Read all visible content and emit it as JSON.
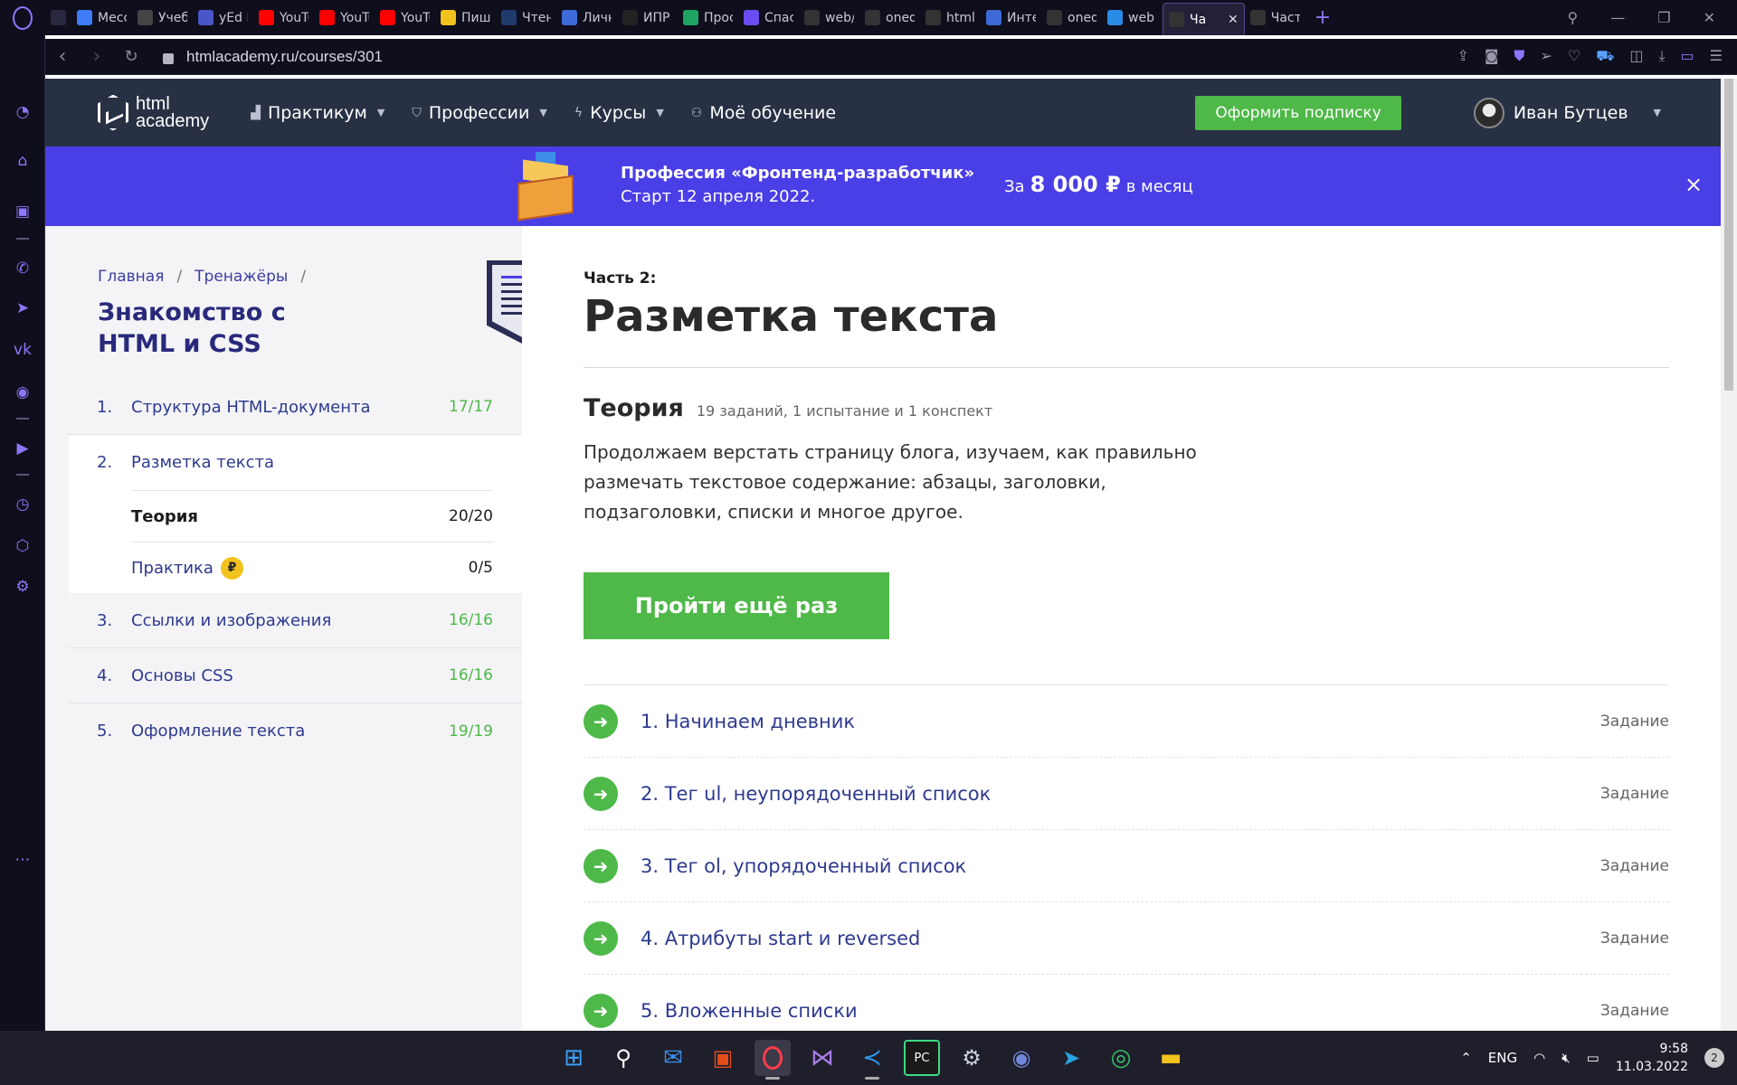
{
  "browser": {
    "tabs": [
      {
        "label": "",
        "color": "#2a2840",
        "icon": "gamepad-icon"
      },
      {
        "label": "Месс",
        "color": "#3d7cf5",
        "icon": "messenger-icon"
      },
      {
        "label": "Учеб",
        "color": "#444",
        "icon": "mail-icon"
      },
      {
        "label": "yEd L",
        "color": "#4a56c8",
        "icon": "yed-icon"
      },
      {
        "label": "YouTu",
        "color": "#ff0000",
        "icon": "youtube-icon"
      },
      {
        "label": "YouTu",
        "color": "#ff0000",
        "icon": "youtube-icon"
      },
      {
        "label": "YouTu",
        "color": "#ff0000",
        "icon": "youtube-icon"
      },
      {
        "label": "Пиш",
        "color": "#f2c21d",
        "icon": "info-icon"
      },
      {
        "label": "Чтен",
        "color": "#203a6b",
        "icon": "r-icon"
      },
      {
        "label": "Личн",
        "color": "#3d6ad6",
        "icon": "page-icon"
      },
      {
        "label": "ИПР",
        "color": "#222",
        "icon": "cd-icon"
      },
      {
        "label": "Прос",
        "color": "#1fa463",
        "icon": "drive-icon"
      },
      {
        "label": "Спас",
        "color": "#6b4cf0",
        "icon": "s-icon"
      },
      {
        "label": "web/",
        "color": "#333",
        "icon": "github-icon"
      },
      {
        "label": "oned",
        "color": "#333",
        "icon": "github-icon"
      },
      {
        "label": "html",
        "color": "#333",
        "icon": "htmlacademy-icon"
      },
      {
        "label": "Инте",
        "color": "#3d6ad6",
        "icon": "p-icon"
      },
      {
        "label": "oned",
        "color": "#333",
        "icon": "github-icon"
      },
      {
        "label": "web",
        "color": "#2a8be6",
        "icon": "onedrive-icon"
      },
      {
        "label": "Ча",
        "color": "#333",
        "icon": "htmlacademy-icon",
        "active": true
      },
      {
        "label": "Част",
        "color": "#333",
        "icon": "htmlacademy-icon"
      }
    ],
    "url": "htmlacademy.ru/courses/301"
  },
  "header": {
    "logo_line1": "html",
    "logo_line2": "academy",
    "nav": [
      "Практикум",
      "Профессии",
      "Курсы",
      "Моё обучение"
    ],
    "subscribe": "Оформить подписку",
    "user_name": "Иван Бутцев"
  },
  "promo": {
    "title": "Профессия «Фронтенд-разработчик»",
    "date": "Старт 12 апреля 2022.",
    "price_prefix": "За",
    "price": "8 000 ₽",
    "price_suffix": "в месяц",
    "close": "×"
  },
  "course": {
    "breadcrumb": [
      "Главная",
      "Тренажёры"
    ],
    "title": "Знакомство с HTML и CSS",
    "lessons": [
      {
        "num": "1.",
        "name": "Структура HTML-документа",
        "progress": "17/17"
      },
      {
        "num": "2.",
        "name": "Разметка текста",
        "progress": "",
        "subs": [
          {
            "name": "Теория",
            "progress": "20/20"
          },
          {
            "name": "Практика",
            "progress": "0/5",
            "badge": "₽"
          }
        ]
      },
      {
        "num": "3.",
        "name": "Ссылки и изображения",
        "progress": "16/16"
      },
      {
        "num": "4.",
        "name": "Основы CSS",
        "progress": "16/16"
      },
      {
        "num": "5.",
        "name": "Оформление текста",
        "progress": "19/19"
      }
    ]
  },
  "main": {
    "part": "Часть 2:",
    "title": "Разметка текста",
    "theory_title": "Теория",
    "theory_count": "19 заданий, 1 испытание и 1 конспект",
    "description": "Продолжаем верстать страницу блога, изучаем, как правильно размечать текстовое содержание: абзацы, заголовки, подзаголовки, списки и многое другое.",
    "retry_button": "Пройти ещё раз",
    "tasks": [
      {
        "name": "1. Начинаем дневник",
        "type": "Задание"
      },
      {
        "name": "2. Тег ul, неупорядоченный список",
        "type": "Задание"
      },
      {
        "name": "3. Тег ol, упорядоченный список",
        "type": "Задание"
      },
      {
        "name": "4. Атрибуты start и reversed",
        "type": "Задание"
      },
      {
        "name": "5. Вложенные списки",
        "type": "Задание"
      }
    ]
  },
  "taskbar": {
    "lang": "ENG",
    "time": "9:58",
    "date": "11.03.2022",
    "notifications": "2"
  },
  "colors": {
    "accent_green": "#4eb848",
    "promo_bg": "#4a3ee6",
    "header_bg": "#283044",
    "link_blue": "#2e3a8e"
  }
}
